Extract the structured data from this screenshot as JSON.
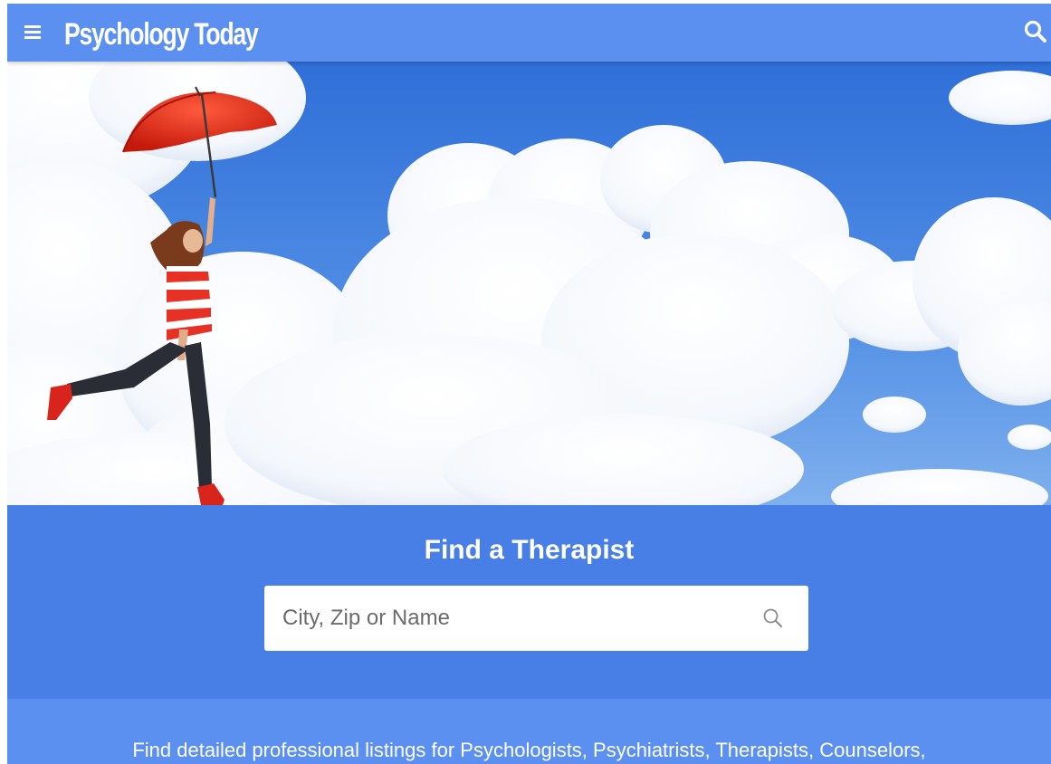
{
  "header": {
    "logo_text": "Psychology Today",
    "menu_icon": "hamburger-menu-icon",
    "search_icon": "search-icon",
    "background_color": "#5b8ff0"
  },
  "hero": {
    "image_description_icon": "hero-image"
  },
  "find_therapist": {
    "title": "Find a Therapist",
    "search_placeholder": "City, Zip or Name",
    "search_value": "",
    "search_icon": "search-icon",
    "background_color": "#477fe6"
  },
  "info": {
    "text": "Find detailed professional listings for Psychologists, Psychiatrists, Therapists, Counselors,",
    "background_color": "#5b8ff0"
  }
}
